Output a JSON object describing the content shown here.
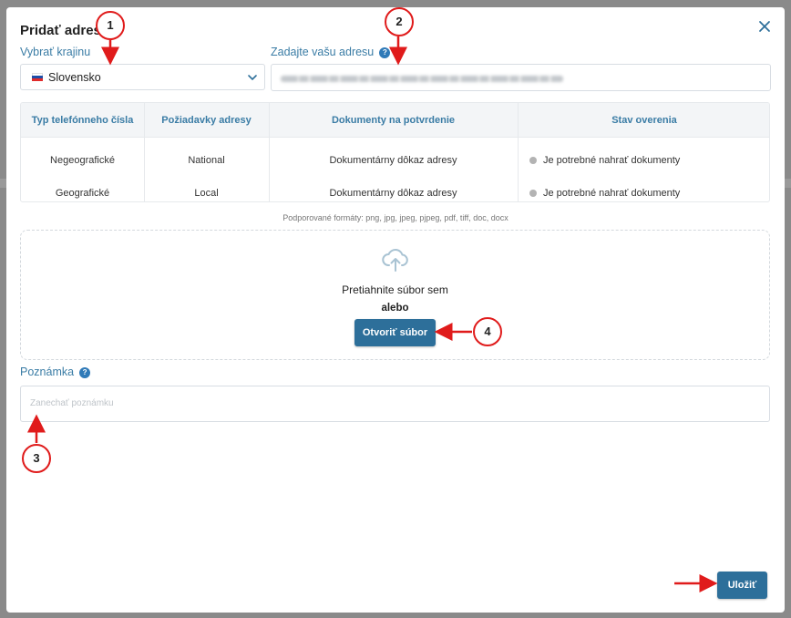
{
  "modal": {
    "title": "Pridať adresu",
    "close_icon": "close-icon"
  },
  "country": {
    "label": "Vybrať krajinu",
    "selected": "Slovensko",
    "flag_icon": "slovakia-flag-icon",
    "chevron_icon": "chevron-down-icon"
  },
  "address": {
    "label": "Zadajte vašu adresu",
    "help_icon": "question-icon",
    "help_glyph": "?",
    "value_blurred": true
  },
  "requirements_table": {
    "headers": [
      "Typ telefónneho čísla",
      "Požiadavky adresy",
      "Dokumenty na potvrdenie",
      "Stav overenia"
    ],
    "rows": [
      [
        "Negeografické",
        "National",
        "Dokumentárny dôkaz adresy",
        "Je potrebné nahrať dokumenty"
      ],
      [
        "Geografické",
        "Local",
        "Dokumentárny dôkaz adresy",
        "Je potrebné nahrať dokumenty"
      ]
    ],
    "status_dot_color": "#b3b3b3"
  },
  "upload": {
    "formats": "Podporované formáty: png, jpg, jpeg, pjpeg, pdf, tiff, doc, docx",
    "cloud_icon": "cloud-upload-icon",
    "drag_text": "Pretiahnite súbor sem",
    "or_text": "alebo",
    "open_button": "Otvoriť súbor"
  },
  "note": {
    "label": "Poznámka",
    "help_glyph": "?",
    "placeholder": "Zanechať poznámku"
  },
  "footer": {
    "save_button": "Uložiť"
  },
  "annotations": {
    "markers": [
      "1",
      "2",
      "3",
      "4"
    ],
    "color": "#e01b1b"
  },
  "colors": {
    "accent": "#2d6f9a",
    "label": "#3a7ca5",
    "backdrop": "#8a8a8a"
  }
}
